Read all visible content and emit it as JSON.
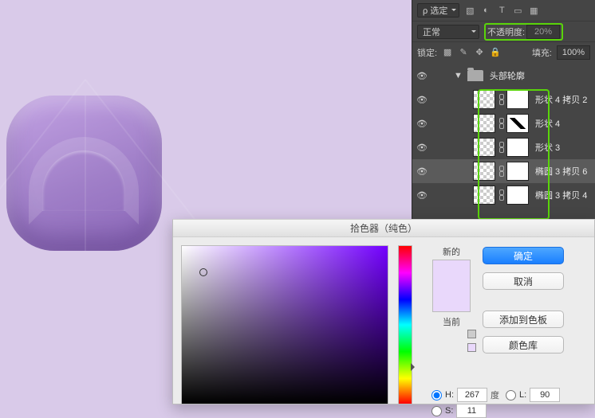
{
  "layers_panel": {
    "kind_label": "ρ 选定",
    "blend_mode": "正常",
    "opacity_label": "不透明度:",
    "opacity_value": "20%",
    "lock_label": "锁定:",
    "fill_label": "填充:",
    "fill_value": "100%",
    "group_name": "头部轮廓",
    "layers": [
      {
        "name": "形状 4 拷贝 2",
        "mask": "white"
      },
      {
        "name": "形状 4",
        "mask": "brush"
      },
      {
        "name": "形状 3",
        "mask": "white"
      },
      {
        "name": "椭圆 3 拷贝 6",
        "mask": "white",
        "selected": true
      },
      {
        "name": "椭圆 3 拷贝 4",
        "mask": "white"
      }
    ]
  },
  "picker": {
    "title": "拾色器（纯色）",
    "new_label": "新的",
    "current_label": "当前",
    "ok": "确定",
    "cancel": "取消",
    "add_swatch": "添加到色板",
    "color_lib": "颜色库",
    "H": {
      "label": "H:",
      "value": "267",
      "unit": "度"
    },
    "S": {
      "label": "S:",
      "value": "11"
    },
    "L": {
      "label": "L:",
      "value": "90"
    }
  }
}
